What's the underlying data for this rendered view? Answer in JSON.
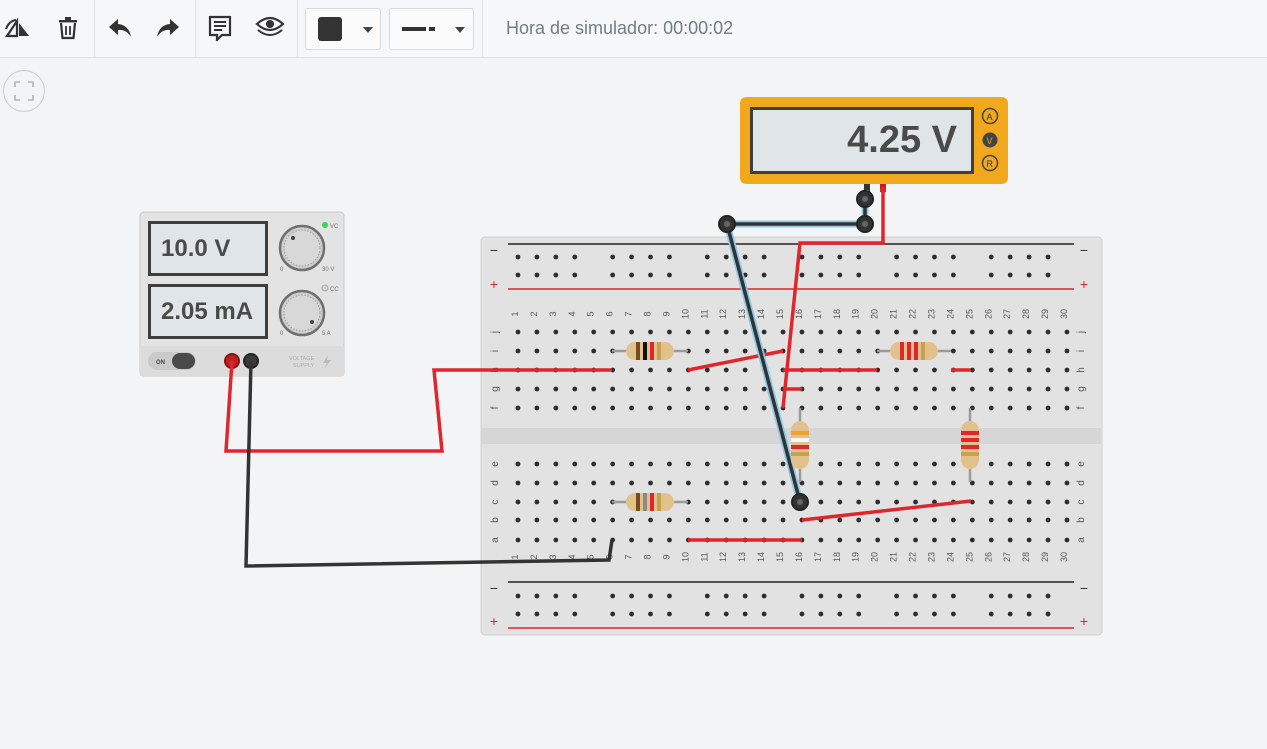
{
  "toolbar": {
    "buttons": [
      {
        "name": "rotate-button",
        "icon": "rotate-icon"
      },
      {
        "name": "delete-button",
        "icon": "trash-icon"
      },
      {
        "name": "undo-button",
        "icon": "undo-icon"
      },
      {
        "name": "redo-button",
        "icon": "redo-icon"
      },
      {
        "name": "notes-button",
        "icon": "notes-icon"
      },
      {
        "name": "visibility-button",
        "icon": "eye-icon"
      }
    ],
    "wire_color": "#333333",
    "wire_style": "line-style-icon"
  },
  "simulator": {
    "time_label": "Hora de simulador: 00:00:02"
  },
  "multimeter": {
    "reading": "4.25 V",
    "modes": [
      "A",
      "V",
      "R"
    ],
    "active_mode": "V",
    "body_color": "#f2a81d"
  },
  "power_supply": {
    "voltage": "10.0 V",
    "current": "2.05 mA",
    "cv_label": "VC",
    "cc_label": "CC",
    "voltage_scale_min": "0",
    "voltage_scale_max": "30 V",
    "current_scale_min": "0",
    "current_scale_max": "5 A",
    "switch_label": "ON",
    "brand_label": "VOLTAGE SUPPLY"
  },
  "breadboard": {
    "columns": [
      "1",
      "2",
      "3",
      "4",
      "5",
      "6",
      "7",
      "8",
      "9",
      "10",
      "11",
      "12",
      "13",
      "14",
      "15",
      "16",
      "17",
      "18",
      "19",
      "20",
      "21",
      "22",
      "23",
      "24",
      "25",
      "26",
      "27",
      "28",
      "29",
      "30"
    ],
    "top_rows": [
      "j",
      "i",
      "h",
      "g",
      "f"
    ],
    "bottom_rows": [
      "e",
      "d",
      "c",
      "b",
      "a"
    ],
    "rail_minus": "−",
    "rail_plus": "+"
  },
  "colors": {
    "wire_red": "#e0262d",
    "wire_black": "#333333",
    "wire_blue": "#8ec8e8",
    "accent": "#f2a81d"
  }
}
